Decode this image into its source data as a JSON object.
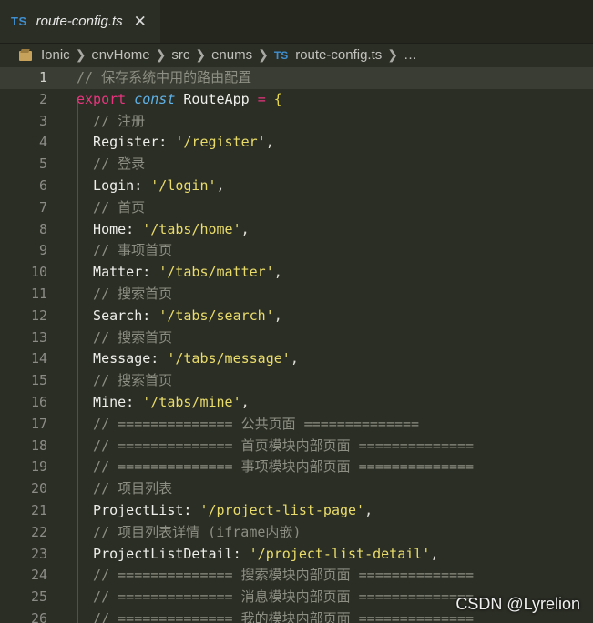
{
  "tab": {
    "badge": "TS",
    "filename": "route-config.ts",
    "close": "✕"
  },
  "breadcrumb": {
    "items": [
      "Ionic",
      "envHome",
      "src",
      "enums"
    ],
    "file_badge": "TS",
    "file": "route-config.ts",
    "trailing": "…"
  },
  "lines": [
    {
      "n": "1",
      "parts": [
        {
          "t": "// 保存系统中用的路由配置",
          "c": "comment"
        }
      ]
    },
    {
      "n": "2",
      "parts": [
        {
          "t": "export",
          "c": "kw"
        },
        {
          "t": " ",
          "c": "id"
        },
        {
          "t": "const",
          "c": "kw2"
        },
        {
          "t": " RouteApp ",
          "c": "id"
        },
        {
          "t": "=",
          "c": "op"
        },
        {
          "t": " ",
          "c": "id"
        },
        {
          "t": "{",
          "c": "brace"
        }
      ]
    },
    {
      "n": "3",
      "parts": [
        {
          "t": "  // 注册",
          "c": "comment"
        }
      ]
    },
    {
      "n": "4",
      "parts": [
        {
          "t": "  Register: ",
          "c": "id"
        },
        {
          "t": "'/register'",
          "c": "str"
        },
        {
          "t": ",",
          "c": "punct"
        }
      ]
    },
    {
      "n": "5",
      "parts": [
        {
          "t": "  // 登录",
          "c": "comment"
        }
      ]
    },
    {
      "n": "6",
      "parts": [
        {
          "t": "  Login: ",
          "c": "id"
        },
        {
          "t": "'/login'",
          "c": "str"
        },
        {
          "t": ",",
          "c": "punct"
        }
      ]
    },
    {
      "n": "7",
      "parts": [
        {
          "t": "  // 首页",
          "c": "comment"
        }
      ]
    },
    {
      "n": "8",
      "parts": [
        {
          "t": "  Home: ",
          "c": "id"
        },
        {
          "t": "'/tabs/home'",
          "c": "str"
        },
        {
          "t": ",",
          "c": "punct"
        }
      ]
    },
    {
      "n": "9",
      "parts": [
        {
          "t": "  // 事项首页",
          "c": "comment"
        }
      ]
    },
    {
      "n": "10",
      "parts": [
        {
          "t": "  Matter: ",
          "c": "id"
        },
        {
          "t": "'/tabs/matter'",
          "c": "str"
        },
        {
          "t": ",",
          "c": "punct"
        }
      ]
    },
    {
      "n": "11",
      "parts": [
        {
          "t": "  // 搜索首页",
          "c": "comment"
        }
      ]
    },
    {
      "n": "12",
      "parts": [
        {
          "t": "  Search: ",
          "c": "id"
        },
        {
          "t": "'/tabs/search'",
          "c": "str"
        },
        {
          "t": ",",
          "c": "punct"
        }
      ]
    },
    {
      "n": "13",
      "parts": [
        {
          "t": "  // 搜索首页",
          "c": "comment"
        }
      ]
    },
    {
      "n": "14",
      "parts": [
        {
          "t": "  Message: ",
          "c": "id"
        },
        {
          "t": "'/tabs/message'",
          "c": "str"
        },
        {
          "t": ",",
          "c": "punct"
        }
      ]
    },
    {
      "n": "15",
      "parts": [
        {
          "t": "  // 搜索首页",
          "c": "comment"
        }
      ]
    },
    {
      "n": "16",
      "parts": [
        {
          "t": "  Mine: ",
          "c": "id"
        },
        {
          "t": "'/tabs/mine'",
          "c": "str"
        },
        {
          "t": ",",
          "c": "punct"
        }
      ]
    },
    {
      "n": "17",
      "parts": [
        {
          "t": "  // ============== 公共页面 ==============",
          "c": "comment"
        }
      ]
    },
    {
      "n": "18",
      "parts": [
        {
          "t": "  // ============== 首页模块内部页面 ==============",
          "c": "comment"
        }
      ]
    },
    {
      "n": "19",
      "parts": [
        {
          "t": "  // ============== 事项模块内部页面 ==============",
          "c": "comment"
        }
      ]
    },
    {
      "n": "20",
      "parts": [
        {
          "t": "  // 项目列表",
          "c": "comment"
        }
      ]
    },
    {
      "n": "21",
      "parts": [
        {
          "t": "  ProjectList: ",
          "c": "id"
        },
        {
          "t": "'/project-list-page'",
          "c": "str"
        },
        {
          "t": ",",
          "c": "punct"
        }
      ]
    },
    {
      "n": "22",
      "parts": [
        {
          "t": "  // 项目列表详情 (iframe内嵌)",
          "c": "comment"
        }
      ]
    },
    {
      "n": "23",
      "parts": [
        {
          "t": "  ProjectListDetail: ",
          "c": "id"
        },
        {
          "t": "'/project-list-detail'",
          "c": "str"
        },
        {
          "t": ",",
          "c": "punct"
        }
      ]
    },
    {
      "n": "24",
      "parts": [
        {
          "t": "  // ============== 搜索模块内部页面 ==============",
          "c": "comment"
        }
      ]
    },
    {
      "n": "25",
      "parts": [
        {
          "t": "  // ============== 消息模块内部页面 ==============",
          "c": "comment"
        }
      ]
    },
    {
      "n": "26",
      "parts": [
        {
          "t": "  // ============== 我的模块内部页面 ==============",
          "c": "comment"
        }
      ]
    }
  ],
  "watermark": "CSDN @Lyrelion"
}
